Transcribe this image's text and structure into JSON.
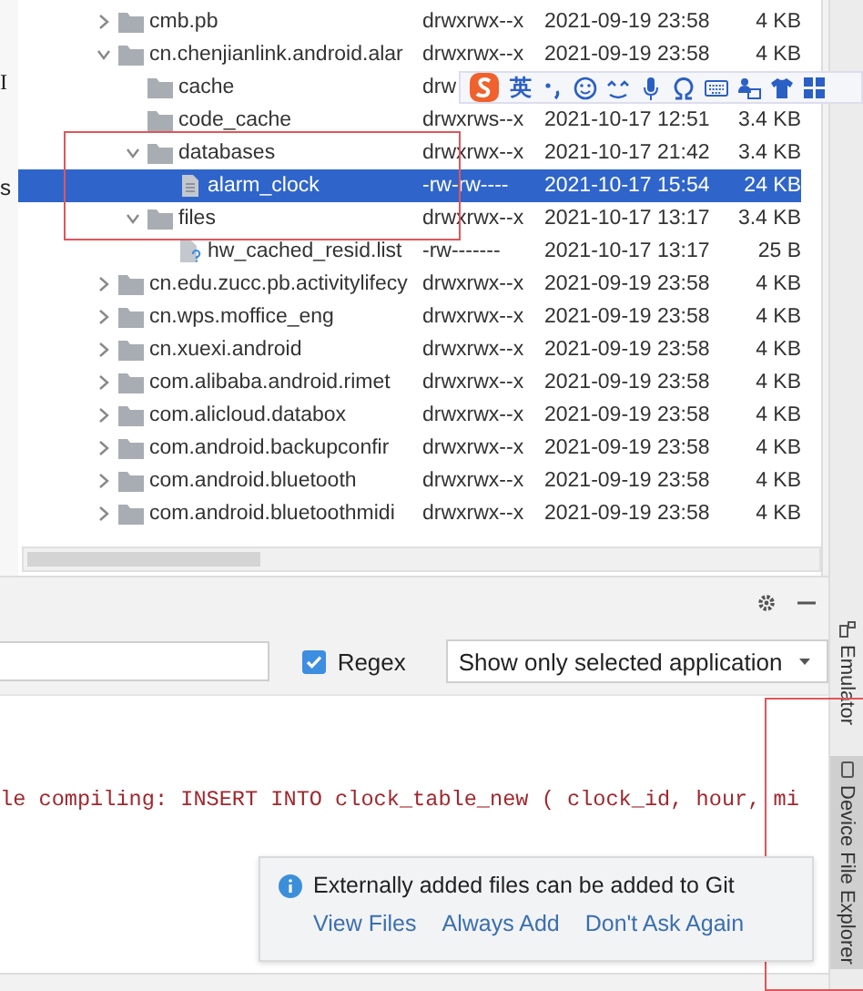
{
  "left_strip": {
    "texts": [
      "I",
      "s"
    ]
  },
  "file_tree": {
    "rows": [
      {
        "kind": "folder",
        "name": "cmb.pb",
        "permissions": "drwxrwx--x",
        "date": "2021-09-19 23:58",
        "size": "4 KB",
        "expanded": false,
        "selected": false
      },
      {
        "kind": "folder",
        "name": "cn.chenjianlink.android.alar",
        "permissions": "drwxrwx--x",
        "date": "2021-09-19 23:58",
        "size": "4 KB",
        "expanded": true,
        "selected": false,
        "children": [
          {
            "kind": "folder",
            "name": "cache",
            "permissions": "drw",
            "selected": false
          },
          {
            "kind": "folder",
            "name": "code_cache",
            "permissions": "drwxrws--x",
            "date": "2021-10-17 12:51",
            "size": "3.4 KB",
            "selected": false
          },
          {
            "kind": "folder",
            "name": "databases",
            "permissions": "drwxrwx--x",
            "date": "2021-10-17 21:42",
            "size": "3.4 KB",
            "expanded": true,
            "selected": false,
            "highlighted": true,
            "children": [
              {
                "kind": "file",
                "name": "alarm_clock",
                "permissions": "-rw-rw----",
                "date": "2021-10-17 15:54",
                "size": "24 KB",
                "selected": true,
                "highlighted": true
              }
            ]
          },
          {
            "kind": "folder",
            "name": "files",
            "permissions": "drwxrwx--x",
            "date": "2021-10-17 13:17",
            "size": "3.4 KB",
            "expanded": true,
            "selected": false,
            "highlighted": true,
            "children": [
              {
                "kind": "unknown-file",
                "name": "hw_cached_resid.list",
                "permissions": "-rw-------",
                "date": "2021-10-17 13:17",
                "size": "25 B",
                "selected": false
              }
            ]
          }
        ]
      },
      {
        "kind": "folder",
        "name": "cn.edu.zucc.pb.activitylifecy",
        "permissions": "drwxrwx--x",
        "date": "2021-09-19 23:58",
        "size": "4 KB",
        "expanded": false,
        "selected": false
      },
      {
        "kind": "folder",
        "name": "cn.wps.moffice_eng",
        "permissions": "drwxrwx--x",
        "date": "2021-09-19 23:58",
        "size": "4 KB",
        "expanded": false,
        "selected": false
      },
      {
        "kind": "folder",
        "name": "cn.xuexi.android",
        "permissions": "drwxrwx--x",
        "date": "2021-09-19 23:58",
        "size": "4 KB",
        "expanded": false,
        "selected": false
      },
      {
        "kind": "folder",
        "name": "com.alibaba.android.rimet",
        "permissions": "drwxrwx--x",
        "date": "2021-09-19 23:58",
        "size": "4 KB",
        "expanded": false,
        "selected": false
      },
      {
        "kind": "folder",
        "name": "com.alicloud.databox",
        "permissions": "drwxrwx--x",
        "date": "2021-09-19 23:58",
        "size": "4 KB",
        "expanded": false,
        "selected": false
      },
      {
        "kind": "folder",
        "name": "com.android.backupconfir",
        "permissions": "drwxrwx--x",
        "date": "2021-09-19 23:58",
        "size": "4 KB",
        "expanded": false,
        "selected": false
      },
      {
        "kind": "folder",
        "name": "com.android.bluetooth",
        "permissions": "drwxrwx--x",
        "date": "2021-09-19 23:58",
        "size": "4 KB",
        "expanded": false,
        "selected": false
      },
      {
        "kind": "folder",
        "name": "com.android.bluetoothmidi",
        "permissions": "drwxrwx--x",
        "date": "2021-09-19 23:58",
        "size": "4 KB",
        "expanded": false,
        "selected": false
      }
    ]
  },
  "ime_toolbar": {
    "label": "英"
  },
  "log_panel": {
    "regex": {
      "label": "Regex",
      "checked": true
    },
    "app_filter": {
      "value": "Show only selected application"
    },
    "lines": [
      "le compiling: INSERT INTO clock_table_new ( clock_id, hour, mi"
    ]
  },
  "notification": {
    "message": "Externally added files can be added to Git",
    "actions": [
      "View Files",
      "Always Add",
      "Don't Ask Again"
    ]
  },
  "side_tabs": [
    {
      "kind": "emulator",
      "label": "Emulator",
      "selected": false
    },
    {
      "kind": "device",
      "label": "Device File Explorer",
      "selected": true,
      "highlighted": true
    }
  ]
}
